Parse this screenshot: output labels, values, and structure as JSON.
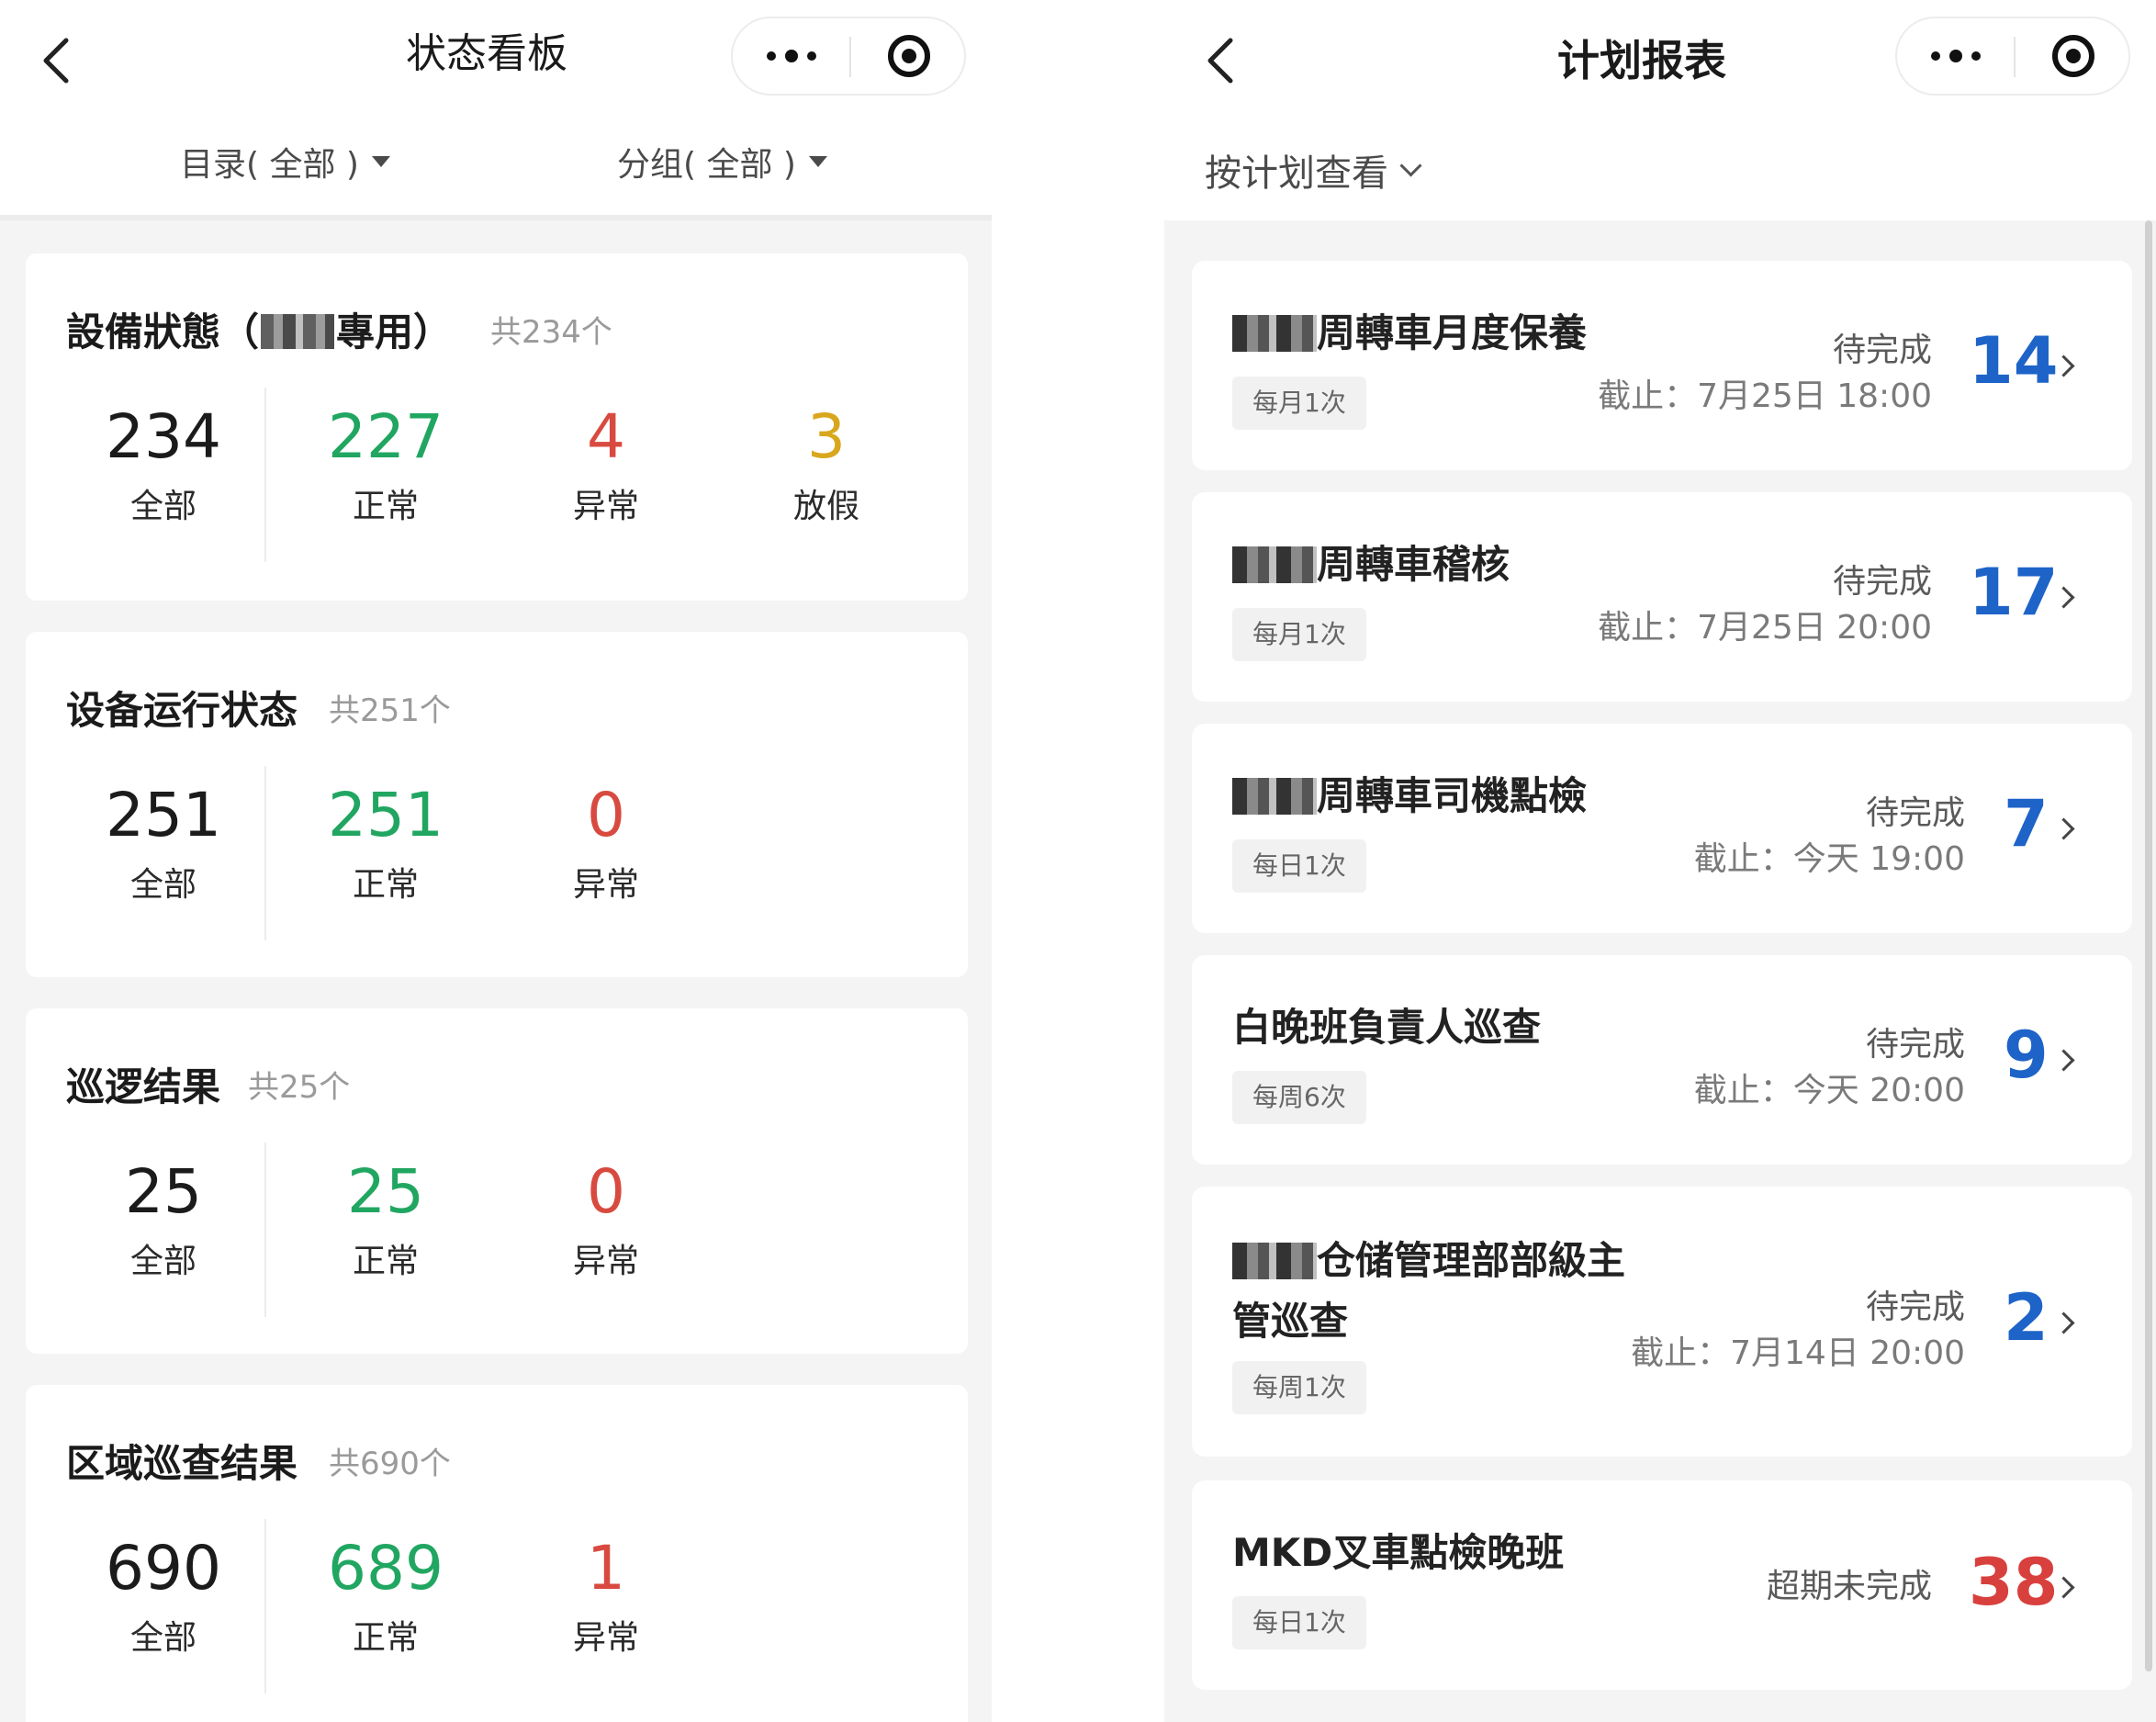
{
  "left": {
    "title": "状态看板",
    "filters": {
      "catalog": "目录( 全部 )",
      "group": "分组( 全部 )"
    },
    "cards": [
      {
        "title_prefix": "設備狀態（",
        "title_suffix": "專用）",
        "count": "共234个",
        "stats": [
          {
            "value": "234",
            "label": "全部"
          },
          {
            "value": "227",
            "label": "正常"
          },
          {
            "value": "4",
            "label": "异常"
          },
          {
            "value": "3",
            "label": "放假"
          }
        ]
      },
      {
        "title": "设备运行状态",
        "count": "共251个",
        "stats": [
          {
            "value": "251",
            "label": "全部"
          },
          {
            "value": "251",
            "label": "正常"
          },
          {
            "value": "0",
            "label": "异常"
          }
        ]
      },
      {
        "title": "巡逻结果",
        "count": "共25个",
        "stats": [
          {
            "value": "25",
            "label": "全部"
          },
          {
            "value": "25",
            "label": "正常"
          },
          {
            "value": "0",
            "label": "异常"
          }
        ]
      },
      {
        "title": "区域巡查结果",
        "count": "共690个",
        "stats": [
          {
            "value": "690",
            "label": "全部"
          },
          {
            "value": "689",
            "label": "正常"
          },
          {
            "value": "1",
            "label": "异常"
          }
        ]
      }
    ]
  },
  "right": {
    "title": "计划报表",
    "view_filter": "按计划查看",
    "items": [
      {
        "name": "周轉車月度保養",
        "freq": "每月1次",
        "status": "待完成",
        "deadline": "截止：7月25日 18:00",
        "count": "14"
      },
      {
        "name": "周轉車稽核",
        "freq": "每月1次",
        "status": "待完成",
        "deadline": "截止：7月25日 20:00",
        "count": "17"
      },
      {
        "name": "周轉車司機點檢",
        "freq": "每日1次",
        "status": "待完成",
        "deadline": "截止：今天 19:00",
        "count": "7"
      },
      {
        "name": "白晚班負責人巡查",
        "freq": "每周6次",
        "status": "待完成",
        "deadline": "截止：今天 20:00",
        "count": "9"
      },
      {
        "name_line1": "仓储管理部部級主",
        "name_line2": "管巡查",
        "freq": "每周1次",
        "status": "待完成",
        "deadline": "截止：7月14日 20:00",
        "count": "2"
      },
      {
        "name": "MKD叉車點檢晚班",
        "freq": "每日1次",
        "status": "超期未完成",
        "count": "38"
      }
    ]
  },
  "colors": {
    "total": "#1b1b1b",
    "normal": "#21a661",
    "abnormal": "#d84a3f",
    "holiday": "#d9a71d",
    "pending_num": "#1d63c8",
    "overdue_num": "#d8403d"
  }
}
